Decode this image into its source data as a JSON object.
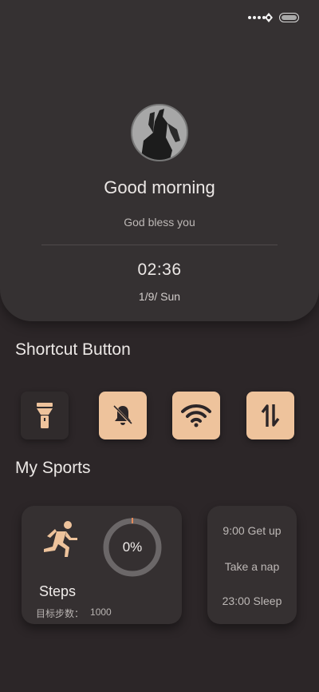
{
  "header": {
    "greeting": "Good morning",
    "blessing": "God bless you",
    "time": "02:36",
    "date": "1/9/ Sun"
  },
  "shortcuts": {
    "title": "Shortcut Button",
    "items": [
      {
        "icon": "flashlight-icon",
        "active": false
      },
      {
        "icon": "bell-off-icon",
        "active": true
      },
      {
        "icon": "wifi-icon",
        "active": true
      },
      {
        "icon": "data-transfer-icon",
        "active": true
      }
    ]
  },
  "sports": {
    "title": "My Sports",
    "steps": {
      "label": "Steps",
      "target_label": "目标步数：",
      "target_value": "1000",
      "progress_text": "0%",
      "progress": 0
    },
    "schedule": [
      "9:00 Get up",
      "Take a nap",
      "23:00 Sleep"
    ]
  },
  "colors": {
    "accent": "#eec39c",
    "background": "#2c2628",
    "card": "#353031"
  }
}
